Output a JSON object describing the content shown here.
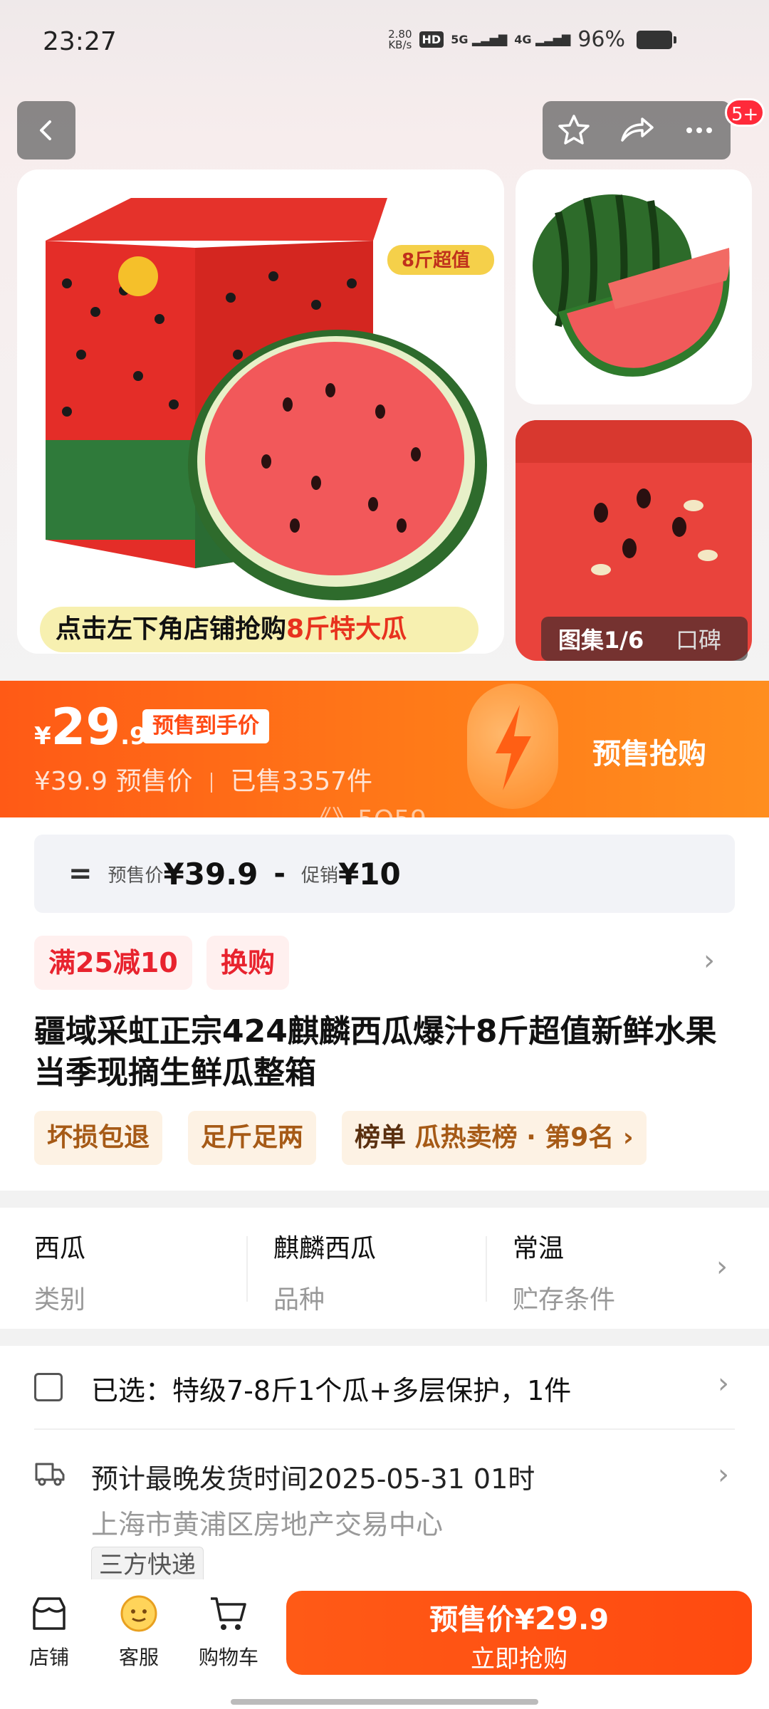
{
  "status": {
    "time": "23:27",
    "speed_value": "2.80",
    "speed_unit": "KB/s",
    "hd": "HD",
    "net1": "5G",
    "net2": "4G",
    "battery": "96%"
  },
  "nav": {
    "badge": "5+"
  },
  "gallery": {
    "box_tag": "8斤超值",
    "promo_prefix": "点击左下角店铺抢购",
    "promo_highlight": "8斤特大瓜",
    "counter": "图集1/6",
    "reviews": "口碑"
  },
  "price": {
    "currency": "¥",
    "integer": "29",
    "decimal": ".9",
    "tag": "预售到手价",
    "original": "¥39.9",
    "original_label": "预售价",
    "sold": "已售3357件",
    "cta": "预售抢购",
    "watermark": "《》5Q59"
  },
  "formula": {
    "eq": "=",
    "presale_label": "预售价",
    "presale_value": "¥39.9",
    "minus": "-",
    "promo_label": "促销",
    "promo_value": "¥10"
  },
  "coupons": [
    "满25减10",
    "换购"
  ],
  "title": "疆域采虹正宗424麒麟西瓜爆汁8斤超值新鲜水果当季现摘生鲜瓜整箱",
  "features": {
    "tag1": "坏损包退",
    "tag2": "足斤足两",
    "rank_label": "榜单",
    "rank_text": "瓜热卖榜 · 第9名"
  },
  "attributes": [
    {
      "value": "西瓜",
      "key": "类别"
    },
    {
      "value": "麒麟西瓜",
      "key": "品种"
    },
    {
      "value": "常温",
      "key": "贮存条件"
    }
  ],
  "selection": {
    "text": "已选：特级7-8斤1个瓜+多层保护，1件"
  },
  "shipping": {
    "time": "预计最晚发货时间2025-05-31 01时",
    "address": "上海市黄浦区房地产交易中心",
    "tag": "三方快递"
  },
  "bottom": {
    "store": "店铺",
    "service": "客服",
    "cart": "购物车",
    "buy_label": "预售价",
    "buy_currency": "¥",
    "buy_integer": "29",
    "buy_decimal": ".9",
    "buy_sub": "立即抢购"
  }
}
